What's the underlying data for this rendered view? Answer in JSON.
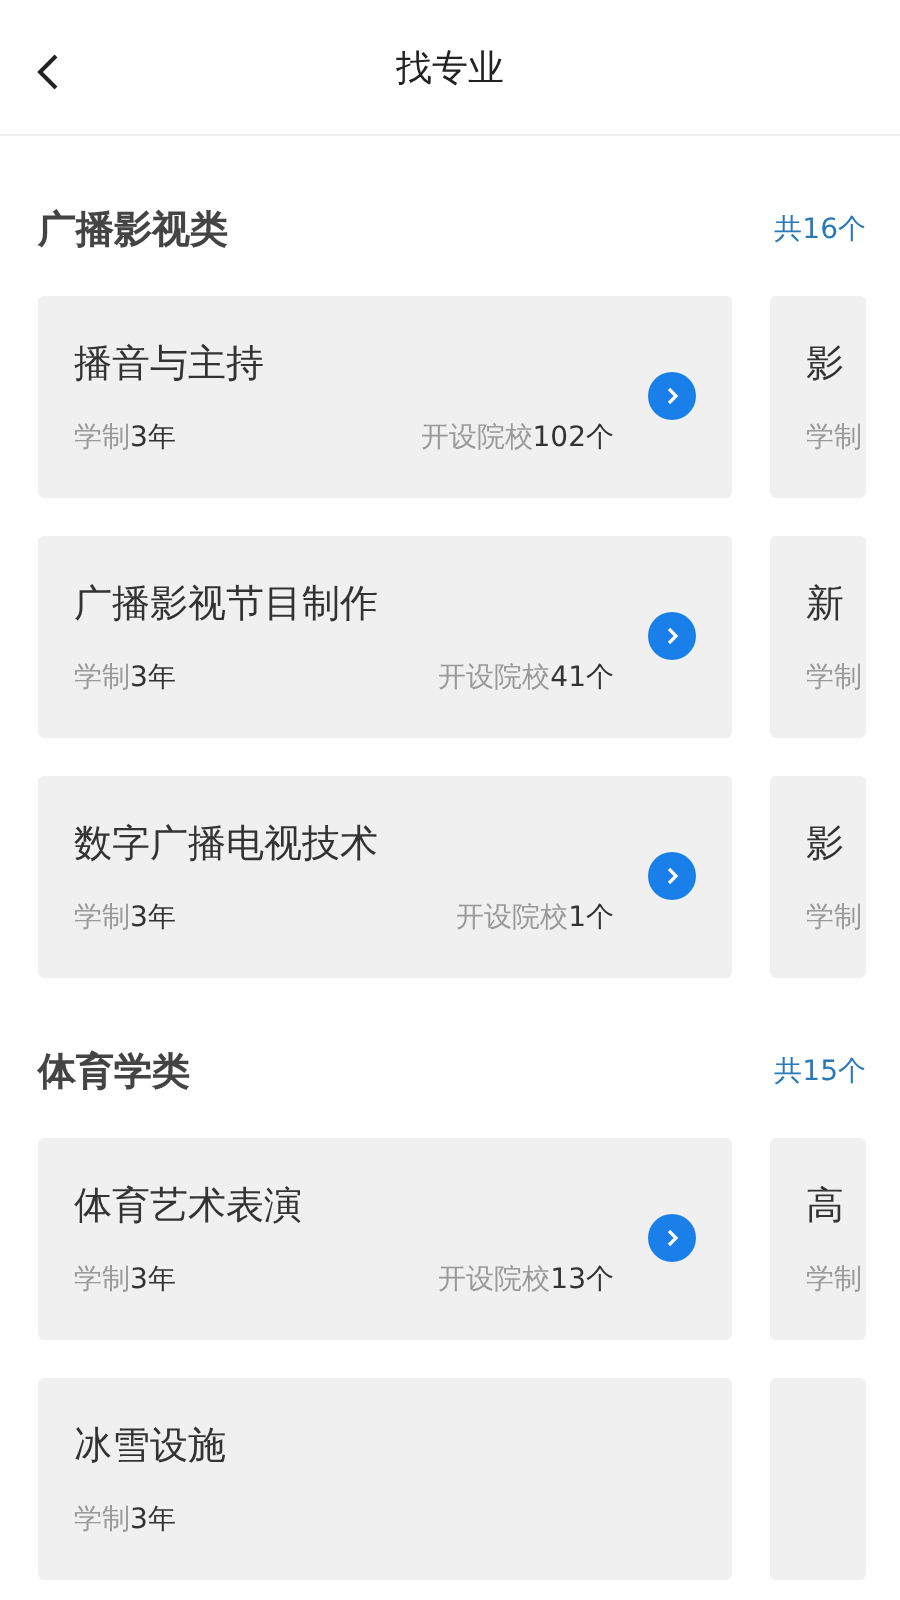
{
  "header": {
    "title": "找专业"
  },
  "sections": [
    {
      "title": "广播影视类",
      "count": "共16个",
      "rows": [
        {
          "main": {
            "name": "播音与主持",
            "duration_label": "学制",
            "duration_value": "3年",
            "schools_label": "开设院校",
            "schools_value": "102个",
            "arrow": true
          },
          "peek": {
            "name": "影",
            "duration_label": "学制"
          }
        },
        {
          "main": {
            "name": "广播影视节目制作",
            "duration_label": "学制",
            "duration_value": "3年",
            "schools_label": "开设院校",
            "schools_value": "41个",
            "arrow": true
          },
          "peek": {
            "name": "新",
            "duration_label": "学制"
          }
        },
        {
          "main": {
            "name": "数字广播电视技术",
            "duration_label": "学制",
            "duration_value": "3年",
            "schools_label": "开设院校",
            "schools_value": "1个",
            "arrow": true
          },
          "peek": {
            "name": "影",
            "duration_label": "学制"
          }
        }
      ]
    },
    {
      "title": "体育学类",
      "count": "共15个",
      "rows": [
        {
          "main": {
            "name": "体育艺术表演",
            "duration_label": "学制",
            "duration_value": "3年",
            "schools_label": "开设院校",
            "schools_value": "13个",
            "arrow": true
          },
          "peek": {
            "name": "高",
            "duration_label": "学制"
          }
        },
        {
          "main": {
            "name": "冰雪设施",
            "duration_label": "学制",
            "duration_value": "3年",
            "arrow": false
          },
          "peek": {}
        }
      ]
    }
  ]
}
